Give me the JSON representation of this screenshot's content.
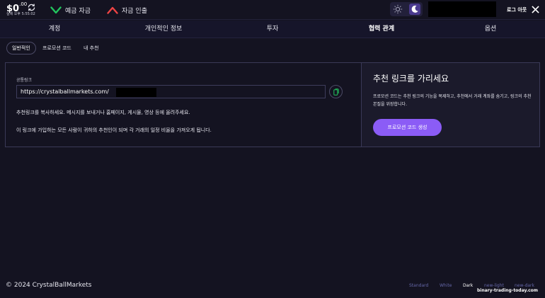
{
  "header": {
    "balance_amount": "$0",
    "balance_cents": ".00",
    "balance_caption": "실제 오후 5:55:02",
    "deposit_label": "예금 자금",
    "withdraw_label": "자금 인출",
    "logout_label": "로그 아웃",
    "colors": {
      "deposit_icon": "#22c55e",
      "withdraw_icon": "#ef4444"
    }
  },
  "nav": {
    "tabs": [
      {
        "label": "계정"
      },
      {
        "label": "개인적인 정보"
      },
      {
        "label": "투자"
      },
      {
        "label": "협력 관계",
        "active": true
      },
      {
        "label": "옵션"
      }
    ]
  },
  "subnav": {
    "tabs": [
      {
        "label": "일반적인",
        "active": true
      },
      {
        "label": "프로모션 코드"
      },
      {
        "label": "내 추천"
      }
    ]
  },
  "referral": {
    "link_label": "공통링크",
    "link_value": "https://crystalballmarkets.com/",
    "description_1": "추천링크를 복사하세요. 메시지를 보내거나 홈페이지, 게시물, 영상 등에 올려주세요.",
    "description_2": "이 링크에 가입하는 모든 사람이 귀하의 추천인이 되며 각 거래의 일정 비율을 가져오게 됩니다."
  },
  "promo": {
    "title": "추천 링크를 가리세요",
    "text": "프로모션 코드는 추천 링크의 기능을 복제하고, 추천에서 거래 계좌를 숨기고, 링크의 추천 본질을 위장합니다.",
    "button_label": "프로모션 코드 생성",
    "accent_color": "#8b5cf6"
  },
  "footer": {
    "copyright": "© 2024 CrystalBallMarkets",
    "themes": [
      {
        "label": "Standard"
      },
      {
        "label": "White"
      },
      {
        "label": "Dark",
        "active": true
      },
      {
        "label": "new-light"
      },
      {
        "label": "new-dark"
      }
    ],
    "watermark": "binary-trading-today.com"
  }
}
